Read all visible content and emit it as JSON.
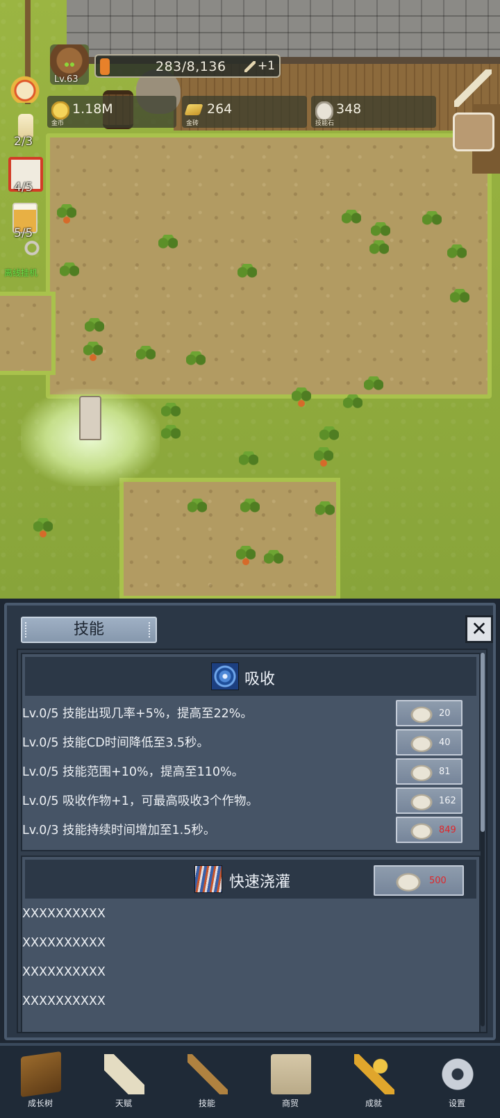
{
  "hud": {
    "level": "Lv.63",
    "xp_text": "283/8,136",
    "xp_bonus": "+1",
    "resources": [
      {
        "icon": "gold-coin-icon",
        "value": "1.18M",
        "label": "金币"
      },
      {
        "icon": "gold-brick-icon",
        "value": "264",
        "label": "金砖"
      },
      {
        "icon": "skill-stone-icon",
        "value": "348",
        "label": "技能石"
      }
    ],
    "side": {
      "candle": "2/3",
      "dice": "4/5",
      "beer": "5/5",
      "idle_label": "离线挂机"
    }
  },
  "panel": {
    "title": "技能",
    "close_icon": "close-x-icon",
    "skills": [
      {
        "name": "吸收",
        "icon": "swirl-vortex-icon",
        "upgrades": [
          {
            "text": "Lv.0/5 技能出现几率+5%，提高至22%。",
            "cost": "20",
            "affordable": true
          },
          {
            "text": "Lv.0/5 技能CD时间降低至3.5秒。",
            "cost": "40",
            "affordable": true
          },
          {
            "text": "Lv.0/5 技能范围+10%，提高至110%。",
            "cost": "81",
            "affordable": true
          },
          {
            "text": "Lv.0/5 吸收作物+1，可最高吸收3个作物。",
            "cost": "162",
            "affordable": true
          },
          {
            "text": "Lv.0/3 技能持续时间增加至1.5秒。",
            "cost": "849",
            "affordable": false
          }
        ]
      },
      {
        "name": "快速浇灌",
        "icon": "water-stream-icon",
        "unlock_cost": "500",
        "unlock_affordable": false,
        "upgrades": [
          {
            "text": "XXXXXXXXXX"
          },
          {
            "text": "XXXXXXXXXX"
          },
          {
            "text": "XXXXXXXXXX"
          },
          {
            "text": "XXXXXXXXXX"
          }
        ]
      }
    ],
    "accent_red": "#e0262a"
  },
  "nav": [
    {
      "label": "成长树",
      "icon": "book-icon"
    },
    {
      "label": "天赋",
      "icon": "scroll-icon"
    },
    {
      "label": "技能",
      "icon": "sword-icon"
    },
    {
      "label": "商贸",
      "icon": "map-icon"
    },
    {
      "label": "成就",
      "icon": "key-icon"
    },
    {
      "label": "设置",
      "icon": "gear-icon"
    }
  ]
}
